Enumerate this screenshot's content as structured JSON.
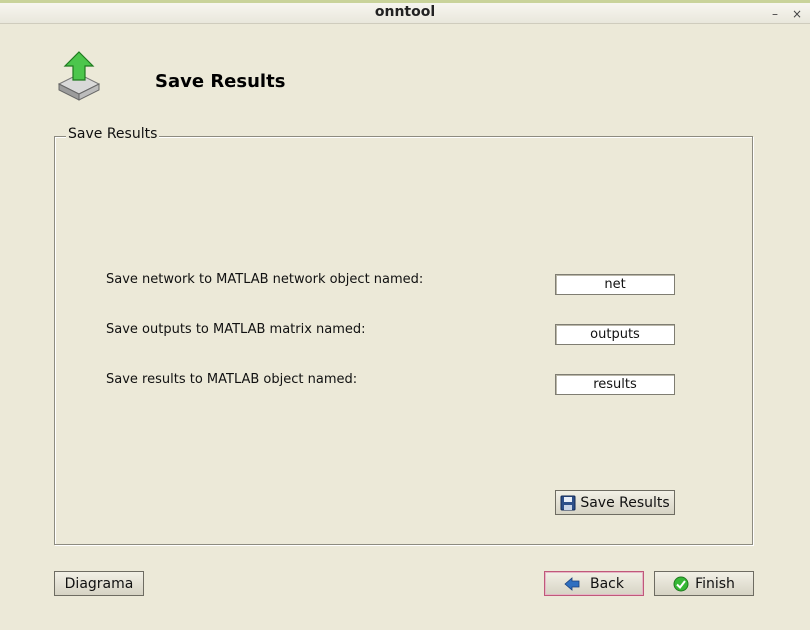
{
  "window": {
    "title": "onntool",
    "minimize_glyph": "–",
    "close_glyph": "×"
  },
  "header": {
    "title": "Save Results",
    "icon": "upload-save-icon"
  },
  "group": {
    "legend": "Save Results",
    "rows": [
      {
        "label": "Save network to MATLAB network object named:",
        "value": "net"
      },
      {
        "label": "Save outputs to MATLAB matrix named:",
        "value": "outputs"
      },
      {
        "label": "Save results to MATLAB object named:",
        "value": "results"
      }
    ],
    "save_button": {
      "label": "Save Results",
      "icon": "floppy-disk-icon"
    }
  },
  "footer": {
    "diagram_label": "Diagrama",
    "back_label": "Back",
    "back_icon": "arrow-left-icon",
    "finish_label": "Finish",
    "finish_icon": "check-circle-icon"
  },
  "colors": {
    "background": "#ece9d8",
    "accent_green": "#36b836",
    "back_arrow": "#2f6fc0",
    "focus_border": "#c0587a"
  }
}
